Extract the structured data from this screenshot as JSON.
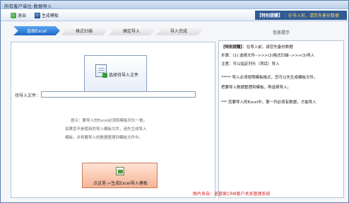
{
  "window": {
    "title": "所有客户单位-数据导入"
  },
  "toolbar": {
    "exit_label": "退出",
    "generate_template_label": "生成模板",
    "tip_title": "【特别提醒】",
    "tip_text": "：在导入前，请您先备份数据"
  },
  "steps": [
    {
      "label": "选择Excel"
    },
    {
      "label": "格式扫描"
    },
    {
      "label": "确定导入"
    },
    {
      "label": "导入完成"
    }
  ],
  "main": {
    "pick_file_label": "选择待导入文件",
    "file_label": "待导入文件：",
    "file_value": "",
    "note_lines": [
      "提示：要导入的Excel必须和模板列头一致。",
      "如果您不是使用的导入模板文件，请先生成导入",
      "模板，并将要导入的数据整理到模板文件中。"
    ],
    "generate_button_label": "点这里->生成Excel导入模板"
  },
  "info": {
    "header": "信息提示",
    "line1_bold": "【特别提醒】",
    "line1_rest": "：在导入前，请您先备份数据",
    "line2": "步骤：(1) 选择文件-->>>(2)格式扫描-->>>(3)导入",
    "line3": "注意：可以指定列头（项目）导入",
    "line4": "***** 导入必须按照模板格式，您可以先生成模板文件，",
    "line5": "把要导入数据整理到模板，再选择导入。",
    "line6": "*** 您要导入的Excel中，第一列必须有数据，才能导入"
  },
  "footer": {
    "credit": "图片来自：总管家CRM客户关系管理系统"
  }
}
